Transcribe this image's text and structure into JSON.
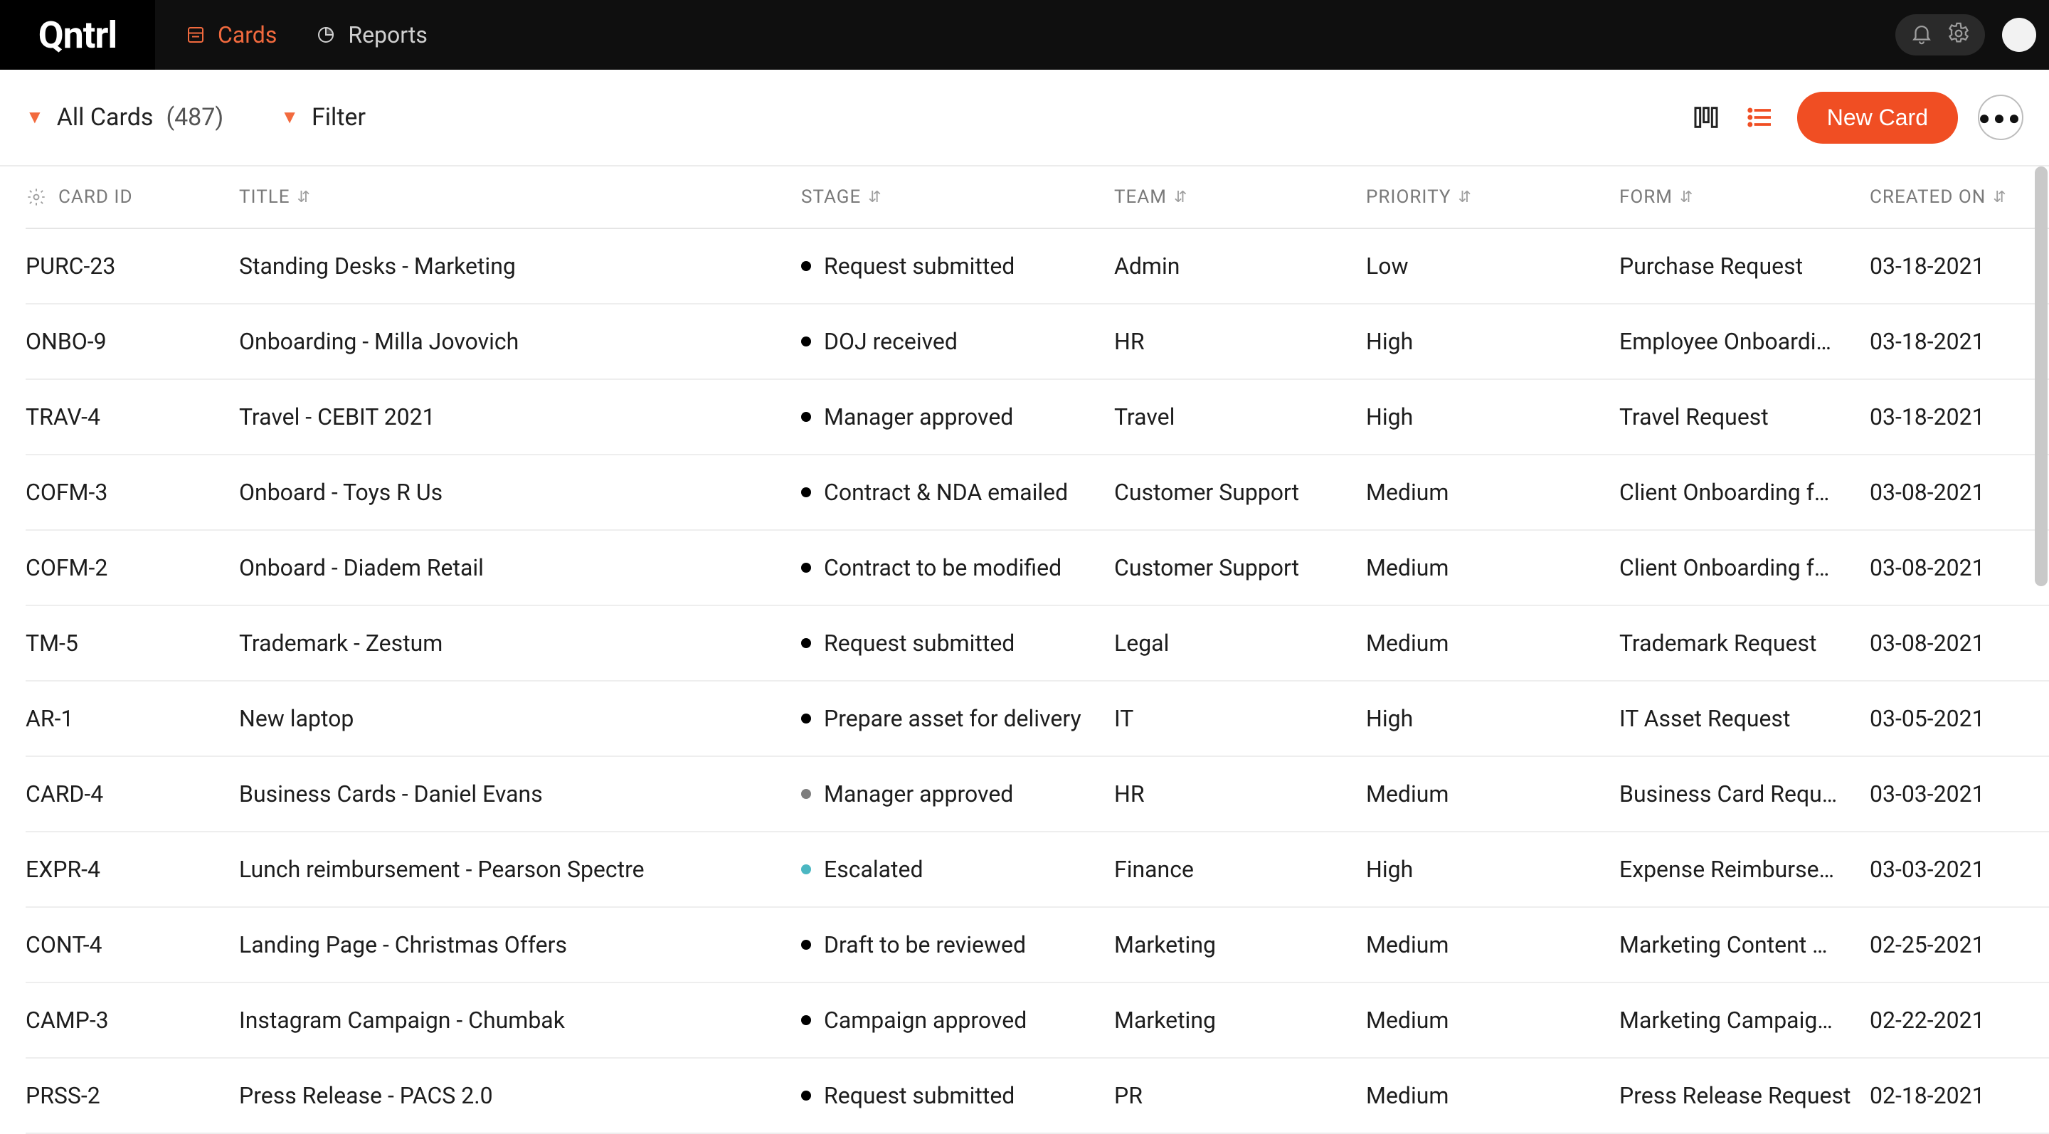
{
  "brand": "Qntrl",
  "nav": {
    "cards": "Cards",
    "reports": "Reports"
  },
  "subbar": {
    "allcards_label": "All Cards",
    "count": "(487)",
    "filter_label": "Filter",
    "newcard_label": "New Card"
  },
  "columns": {
    "card_id": "CARD ID",
    "title": "TITLE",
    "stage": "STAGE",
    "team": "TEAM",
    "priority": "PRIORITY",
    "form": "FORM",
    "created_on": "CREATED ON"
  },
  "rows": [
    {
      "id": "PURC-23",
      "title": "Standing Desks - Marketing",
      "stage": "Request submitted",
      "dot": "black",
      "team": "Admin",
      "priority": "Low",
      "form": "Purchase Request",
      "created": "03-18-2021"
    },
    {
      "id": "ONBO-9",
      "title": "Onboarding - Milla Jovovich",
      "stage": "DOJ received",
      "dot": "black",
      "team": "HR",
      "priority": "High",
      "form": "Employee Onboardi…",
      "created": "03-18-2021"
    },
    {
      "id": "TRAV-4",
      "title": "Travel - CEBIT 2021",
      "stage": "Manager approved",
      "dot": "black",
      "team": "Travel",
      "priority": "High",
      "form": "Travel Request",
      "created": "03-18-2021"
    },
    {
      "id": "COFM-3",
      "title": "Onboard - Toys R Us",
      "stage": "Contract & NDA emailed",
      "dot": "black",
      "team": "Customer Support",
      "priority": "Medium",
      "form": "Client Onboarding f…",
      "created": "03-08-2021"
    },
    {
      "id": "COFM-2",
      "title": "Onboard - Diadem Retail",
      "stage": "Contract to be modified",
      "dot": "black",
      "team": "Customer Support",
      "priority": "Medium",
      "form": "Client Onboarding f…",
      "created": "03-08-2021"
    },
    {
      "id": "TM-5",
      "title": "Trademark - Zestum",
      "stage": "Request submitted",
      "dot": "black",
      "team": "Legal",
      "priority": "Medium",
      "form": "Trademark Request",
      "created": "03-08-2021"
    },
    {
      "id": "AR-1",
      "title": "New laptop",
      "stage": "Prepare asset for delivery",
      "dot": "black",
      "team": "IT",
      "priority": "High",
      "form": "IT Asset Request",
      "created": "03-05-2021"
    },
    {
      "id": "CARD-4",
      "title": "Business Cards - Daniel Evans",
      "stage": "Manager approved",
      "dot": "grey",
      "team": "HR",
      "priority": "Medium",
      "form": "Business Card Requ…",
      "created": "03-03-2021"
    },
    {
      "id": "EXPR-4",
      "title": "Lunch reimbursement - Pearson Spectre",
      "stage": "Escalated",
      "dot": "teal",
      "team": "Finance",
      "priority": "High",
      "form": "Expense Reimburse…",
      "created": "03-03-2021"
    },
    {
      "id": "CONT-4",
      "title": "Landing Page - Christmas Offers",
      "stage": "Draft to be reviewed",
      "dot": "black",
      "team": "Marketing",
      "priority": "Medium",
      "form": "Marketing Content …",
      "created": "02-25-2021"
    },
    {
      "id": "CAMP-3",
      "title": "Instagram Campaign - Chumbak",
      "stage": "Campaign approved",
      "dot": "black",
      "team": "Marketing",
      "priority": "Medium",
      "form": "Marketing Campaig…",
      "created": "02-22-2021"
    },
    {
      "id": "PRSS-2",
      "title": "Press Release - PACS 2.0",
      "stage": "Request submitted",
      "dot": "black",
      "team": "PR",
      "priority": "Medium",
      "form": "Press Release Request",
      "created": "02-18-2021"
    }
  ]
}
